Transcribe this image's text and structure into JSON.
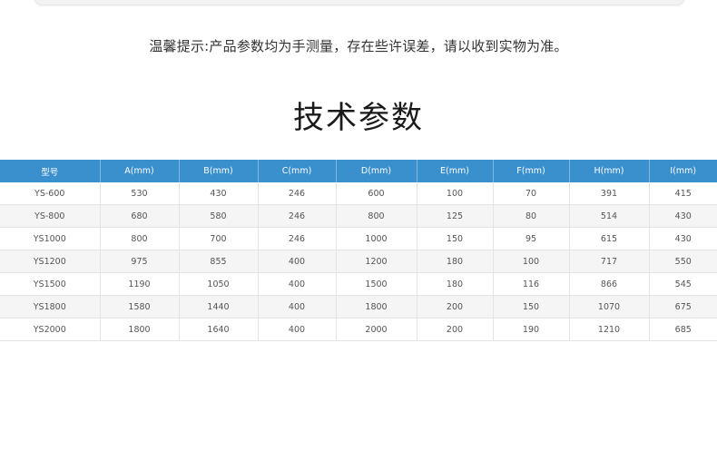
{
  "notice": "温馨提示:产品参数均为手测量，存在些许误差，请以收到实物为准。",
  "title": "技术参数",
  "table": {
    "headers": [
      "型号",
      "A(mm)",
      "B(mm)",
      "C(mm)",
      "D(mm)",
      "E(mm)",
      "F(mm)",
      "H(mm)",
      "I(mm)"
    ],
    "rows": [
      [
        "YS-600",
        "530",
        "430",
        "246",
        "600",
        "100",
        "70",
        "391",
        "415"
      ],
      [
        "YS-800",
        "680",
        "580",
        "246",
        "800",
        "125",
        "80",
        "514",
        "430"
      ],
      [
        "YS1000",
        "800",
        "700",
        "246",
        "1000",
        "150",
        "95",
        "615",
        "430"
      ],
      [
        "YS1200",
        "975",
        "855",
        "400",
        "1200",
        "180",
        "100",
        "717",
        "550"
      ],
      [
        "YS1500",
        "1190",
        "1050",
        "400",
        "1500",
        "180",
        "116",
        "866",
        "545"
      ],
      [
        "YS1800",
        "1580",
        "1440",
        "400",
        "1800",
        "200",
        "150",
        "1070",
        "675"
      ],
      [
        "YS2000",
        "1800",
        "1640",
        "400",
        "2000",
        "200",
        "190",
        "1210",
        "685"
      ]
    ]
  },
  "colors": {
    "header_bg": "#3a8fcd",
    "stripe_bg": "#f5f5f5"
  }
}
